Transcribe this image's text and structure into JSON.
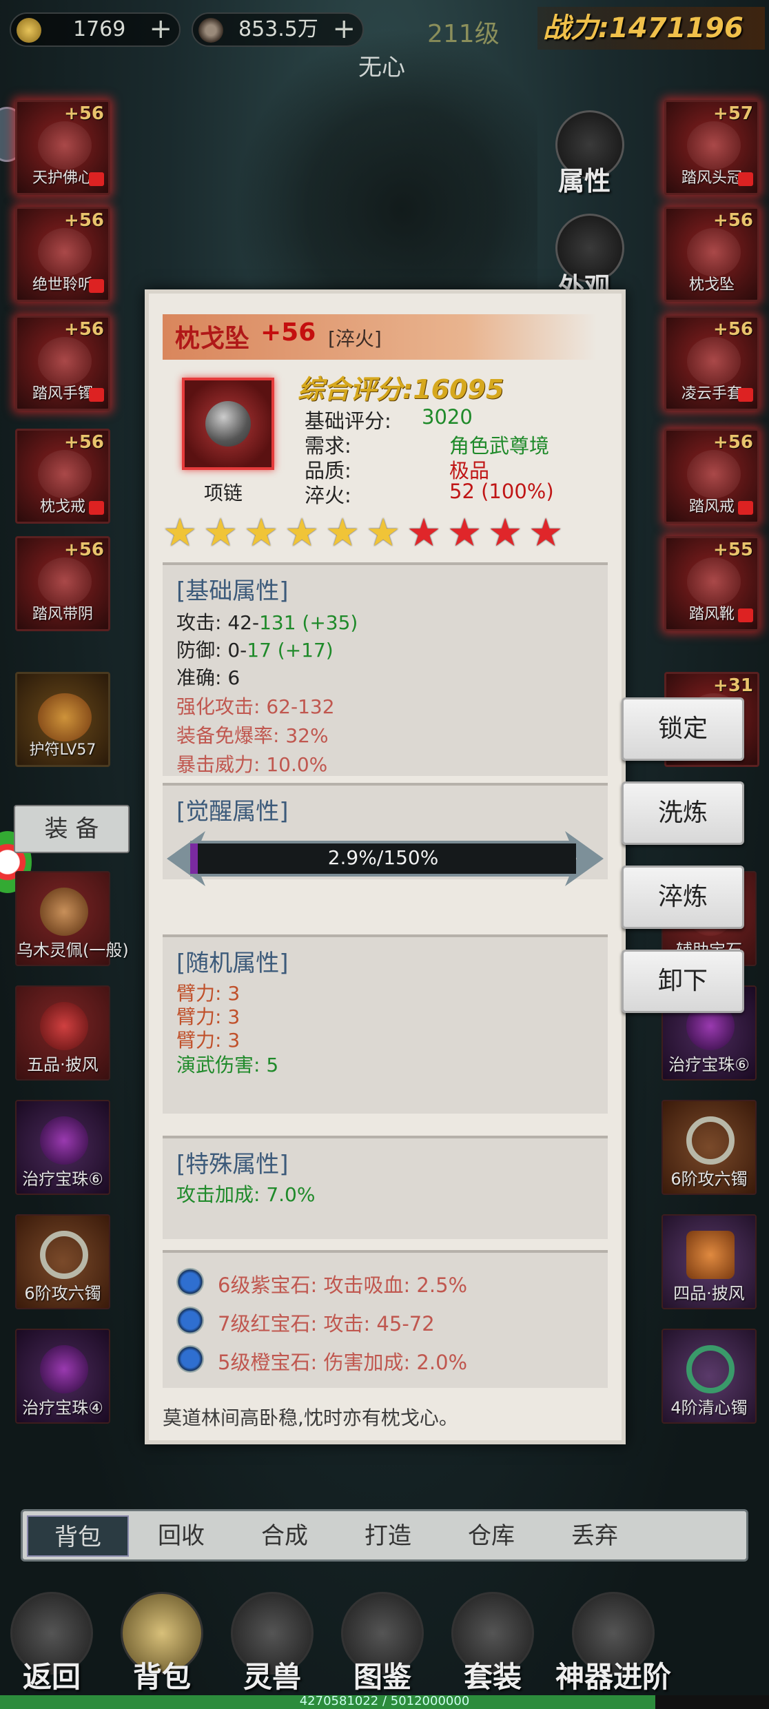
{
  "top_bar": {
    "ingots": "1769",
    "coins": "853.5万",
    "level": "211级",
    "power_label": "战力:",
    "power_value": "1471196",
    "hero_name": "无心"
  },
  "equip_slots_left": [
    {
      "name": "天护佛心",
      "plus": "+56"
    },
    {
      "name": "绝世聆听",
      "plus": "+56"
    },
    {
      "name": "踏风手镯",
      "plus": "+56"
    },
    {
      "name": "枕戈戒",
      "plus": "+56"
    },
    {
      "name": "踏风带阴",
      "plus": "+56"
    },
    {
      "name": "护符LV57",
      "plus": ""
    }
  ],
  "equip_slots_right": [
    {
      "name": "踏风头冠",
      "plus": "+57"
    },
    {
      "name": "枕戈坠",
      "plus": "+56"
    },
    {
      "name": "凌云手套",
      "plus": "+56"
    },
    {
      "name": "踏风戒",
      "plus": "+56"
    },
    {
      "name": "踏风靴",
      "plus": "+55"
    },
    {
      "name": "",
      "plus": "+31"
    }
  ],
  "side_buttons": {
    "attributes": "属性",
    "appearance": "外观"
  },
  "equip_tab": "装 备",
  "inventory_left": [
    {
      "name": "乌木灵佩(一般)"
    },
    {
      "name": "五品·披风"
    },
    {
      "name": "治疗宝珠⑥"
    },
    {
      "name": "6阶攻六镯"
    },
    {
      "name": "治疗宝珠④"
    }
  ],
  "inventory_right": [
    {
      "name": "辅助宝石"
    },
    {
      "name": "治疗宝珠⑥"
    },
    {
      "name": "6阶攻六镯"
    },
    {
      "name": "四品·披风"
    },
    {
      "name": "4阶清心镯"
    }
  ],
  "item_popup": {
    "name": "枕戈坠",
    "enhance": "+56",
    "tag": "[淬火]",
    "score": "综合评分:16095",
    "type": "项链",
    "base_score_label": "基础评分:",
    "base_score_value": "3020",
    "require_label": "需求:",
    "require_value": "角色武尊境",
    "quality_label": "品质:",
    "quality_value": "极品",
    "temper_label": "淬火:",
    "temper_value": "52 (100%)",
    "stars_gold": 6,
    "stars_red": 4,
    "base_section": {
      "title": "[基础属性]",
      "attack_label": "攻击: 42-",
      "attack_value": "131 (+35)",
      "defense_label": "防御: 0-",
      "defense_value": "17 (+17)",
      "accuracy": "准确: 6",
      "enhanced_attack": "强化攻击: 62-132",
      "anti_break": "装备免爆率: 32%",
      "crit_power": "暴击威力: 10.0%"
    },
    "awaken_section": {
      "title": "[觉醒属性]",
      "progress_text": "2.9%/150%",
      "progress": 0.0193
    },
    "random_section": {
      "title": "[随机属性]",
      "lines": [
        "臂力: 3",
        "臂力: 3",
        "臂力: 3"
      ],
      "martial_dmg": "演武伤害: 5"
    },
    "special_section": {
      "title": "[特殊属性]",
      "line": "攻击加成: 7.0%"
    },
    "gems": [
      "6级紫宝石: 攻击吸血: 2.5%",
      "7级红宝石: 攻击: 45-72",
      "5级橙宝石: 伤害加成: 2.0%"
    ],
    "quote": "莫道林间高卧稳,忱时亦有枕戈心。"
  },
  "actions": [
    "锁定",
    "洗炼",
    "淬炼",
    "卸下"
  ],
  "sub_tabs": [
    "背包",
    "回收",
    "合成",
    "打造",
    "仓库",
    "丢弃"
  ],
  "nav": [
    "返回",
    "背包",
    "灵兽",
    "图鉴",
    "套装",
    "神器进阶"
  ],
  "exp_text": "4270581022 / 5012000000",
  "exp_progress": 0.852,
  "colors": {
    "green": "#1f8a2a",
    "red": "#c01616",
    "stat_red": "#c0574f",
    "brown": "#c0502a"
  }
}
